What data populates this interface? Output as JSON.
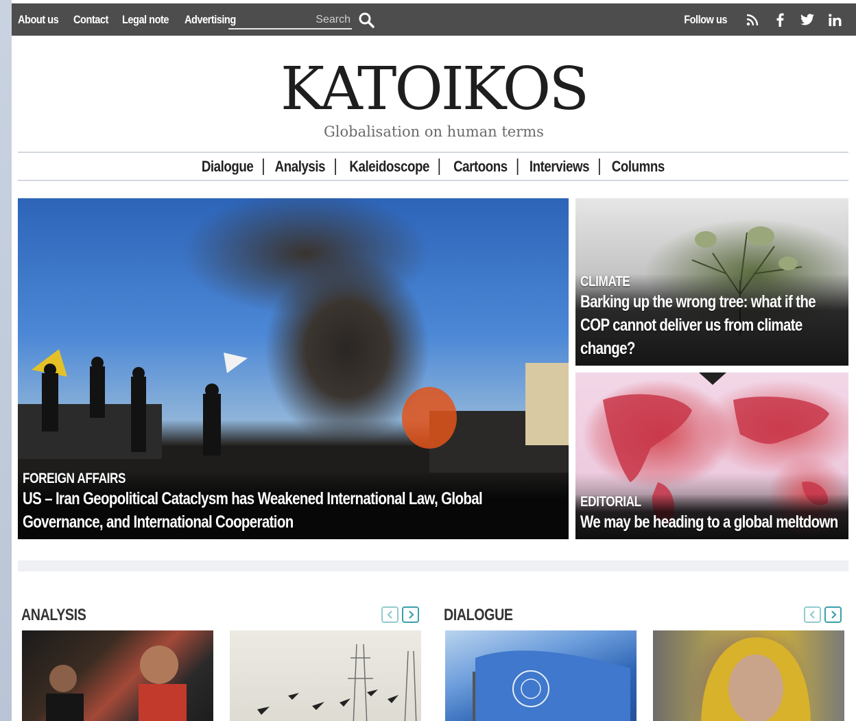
{
  "topbar": {
    "links": [
      "About us",
      "Contact",
      "Legal note",
      "Advertising"
    ],
    "search_placeholder": "Search",
    "follow_label": "Follow us",
    "social_icons": [
      "rss-icon",
      "facebook-icon",
      "twitter-icon",
      "linkedin-icon"
    ]
  },
  "masthead": {
    "logo": "KATOIKOS",
    "tagline": "Globalisation on human terms"
  },
  "nav": [
    "Dialogue",
    "Analysis",
    "Kaleidoscope",
    "Cartoons",
    "Interviews",
    "Columns"
  ],
  "featured": {
    "main": {
      "category": "FOREIGN AFFAIRS",
      "headline": "US – Iran Geopolitical Cataclysm has Weakened International Law, Global Governance, and International Cooperation"
    },
    "climate": {
      "category": "CLIMATE",
      "headline": "Barking up the wrong tree: what if the COP cannot deliver us from climate change?"
    },
    "editorial": {
      "category": "EDITORIAL",
      "headline": "We may be heading to a global meltdown"
    }
  },
  "sections": {
    "analysis": {
      "title": "ANALYSIS"
    },
    "dialogue": {
      "title": "DIALOGUE"
    }
  },
  "colors": {
    "topbar": "#4d4d4d",
    "accent": "#39a0a9",
    "text": "#222222"
  }
}
